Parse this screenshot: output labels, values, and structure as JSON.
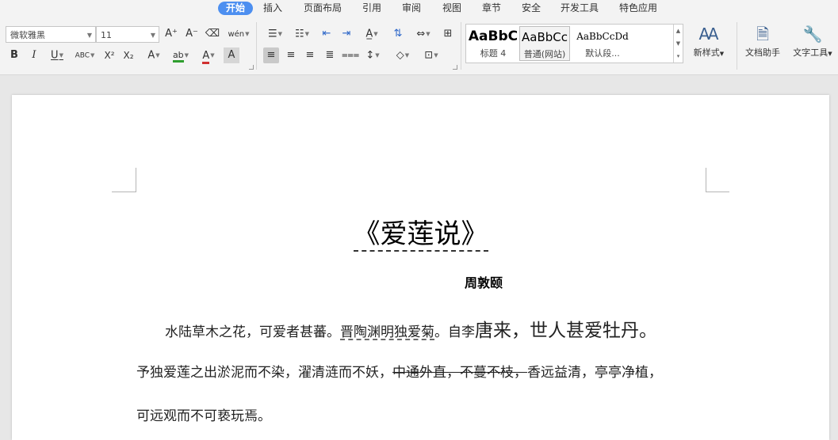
{
  "menu": {
    "tabs": [
      "开始",
      "插入",
      "页面布局",
      "引用",
      "审阅",
      "视图",
      "章节",
      "安全",
      "开发工具",
      "特色应用"
    ]
  },
  "toolbar": {
    "font_name": "微软雅黑",
    "font_size": "11",
    "font_grow": "A⁺",
    "font_shrink": "A⁻",
    "bold": "B",
    "italic": "I",
    "underline": "U",
    "strike_label": "ABC",
    "superscript": "X²",
    "subscript": "X₂",
    "highlight_label": "ab",
    "font_color_label": "A",
    "char_shade_label": "A",
    "phonetic_label": "wén",
    "text_direction_label": "A"
  },
  "styles": {
    "items": [
      {
        "sample": "AaBbC",
        "name": "标题 4"
      },
      {
        "sample": "AaBbCc",
        "name": "普通(网站)"
      },
      {
        "sample": "AaBbCcDd",
        "name": "默认段..."
      }
    ],
    "new_style": "新样式",
    "doc_assistant": "文档助手",
    "text_tools": "文字工具"
  },
  "colors": {
    "accent": "#4d8ff0",
    "highlight": "#2f9e2f",
    "font_color": "#d03030"
  },
  "icons": {
    "clear_format": "eraser-icon",
    "bullets": "bullet-list-icon",
    "numbering": "numbered-list-icon",
    "indent_decrease": "indent-decrease-icon",
    "indent_increase": "indent-increase-icon",
    "sort": "sort-icon",
    "line_spacing": "line-spacing-icon",
    "border": "border-icon",
    "doc_assistant": "document-helper-icon",
    "text_tools": "wrench-icon"
  },
  "document": {
    "title": "《爱莲说》",
    "author": "周敦颐",
    "line1": {
      "a": "水陆草木之花，可爱者甚蕃。",
      "b": "晋陶渊明独爱菊",
      "c": "。自李",
      "d": "唐来，世人甚爱牡丹。"
    },
    "line2": {
      "a": "予独爱莲之出淤泥而不染，濯清涟而不妖，",
      "b": "中通外直，不蔓不枝，",
      "c": "香远益清，亭亭净植，"
    },
    "line3": "可远观而不可亵玩焉。"
  }
}
